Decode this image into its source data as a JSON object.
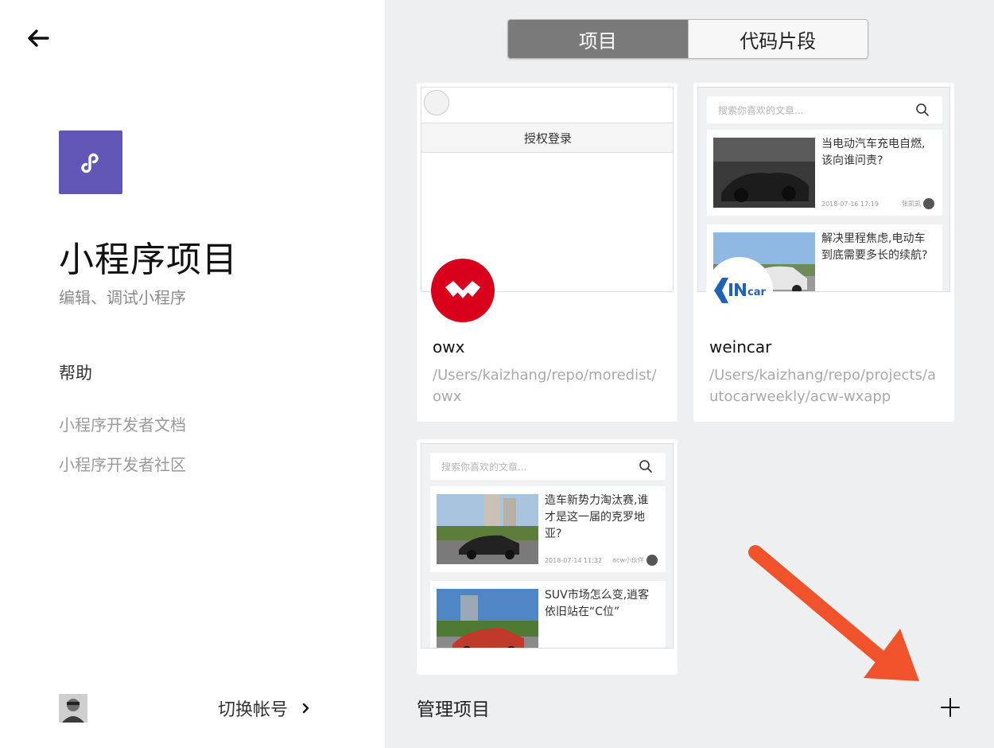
{
  "left": {
    "title": "小程序项目",
    "subtitle": "编辑、调试小程序",
    "help_title": "帮助",
    "help_links": [
      "小程序开发者文档",
      "小程序开发者社区"
    ],
    "switch_account": "切换帐号"
  },
  "tabs": [
    {
      "label": "项目",
      "active": true
    },
    {
      "label": "代码片段",
      "active": false
    }
  ],
  "projects": [
    {
      "name": "owx",
      "path": "/Users/kaizhang/repo/moredist/owx",
      "preview": {
        "auth_button": "授权登录"
      }
    },
    {
      "name": "weincar",
      "path": "/Users/kaizhang/repo/projects/autocarweekly/acw-wxapp",
      "preview": {
        "search_placeholder": "搜索你喜欢的文章...",
        "articles": [
          {
            "title": "当电动汽车充电自燃,该向谁问责?",
            "date": "2018-07-16 17:19",
            "author": "张凯凯"
          },
          {
            "title": "解决里程焦虑,电动车到底需要多长的续航?",
            "date": "",
            "author": ""
          }
        ]
      }
    },
    {
      "name": "",
      "path": "",
      "preview": {
        "search_placeholder": "搜索你喜欢的文章...",
        "articles": [
          {
            "title": "造车新势力淘汰赛,谁才是这一届的克罗地亚?",
            "date": "2018-07-14 11:32",
            "author": "acw小伙伴"
          },
          {
            "title": "SUV市场怎么变,逍客依旧站在“C位”",
            "date": "",
            "author": ""
          }
        ]
      }
    }
  ],
  "manage_label": "管理项目",
  "colors": {
    "logo_bg": "#6156b5",
    "right_bg": "#eeeff1",
    "active_tab": "#7a7a7a",
    "arrow": "#f0532b",
    "owx_icon": "#d9001b",
    "weincar_icon": "#1f63b8"
  }
}
